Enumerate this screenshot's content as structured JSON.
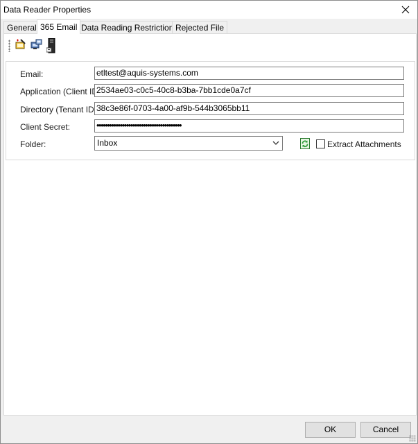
{
  "window": {
    "title": "Data Reader Properties"
  },
  "tabs": [
    {
      "label": "General"
    },
    {
      "label": "365 Email"
    },
    {
      "label": "Data Reading Restrictions"
    },
    {
      "label": "Rejected File"
    }
  ],
  "active_tab": "365 Email",
  "toolbar": {
    "icons": [
      "edit-icon",
      "email-connection-icon",
      "server-icon"
    ]
  },
  "form": {
    "email_label": "Email:",
    "email_value": "etltest@aquis-systems.com",
    "client_id_label": "Application (Client ID):",
    "client_id_value": "2534ae03-c0c5-40c8-b3ba-7bb1cde0a7cf",
    "tenant_id_label": "Directory (Tenant ID):",
    "tenant_id_value": "38c3e86f-0703-4a00-af9b-544b3065bb11",
    "secret_label": "Client Secret:",
    "secret_value": "••••••••••••••••••••••••••••••••••••••••",
    "folder_label": "Folder:",
    "folder_value": "Inbox",
    "extract_attachments_label": "Extract Attachments",
    "extract_attachments_checked": false
  },
  "footer": {
    "ok_label": "OK",
    "cancel_label": "Cancel"
  },
  "colors": {
    "accent_green": "#2e9e3a",
    "border": "#7a7a7a"
  }
}
